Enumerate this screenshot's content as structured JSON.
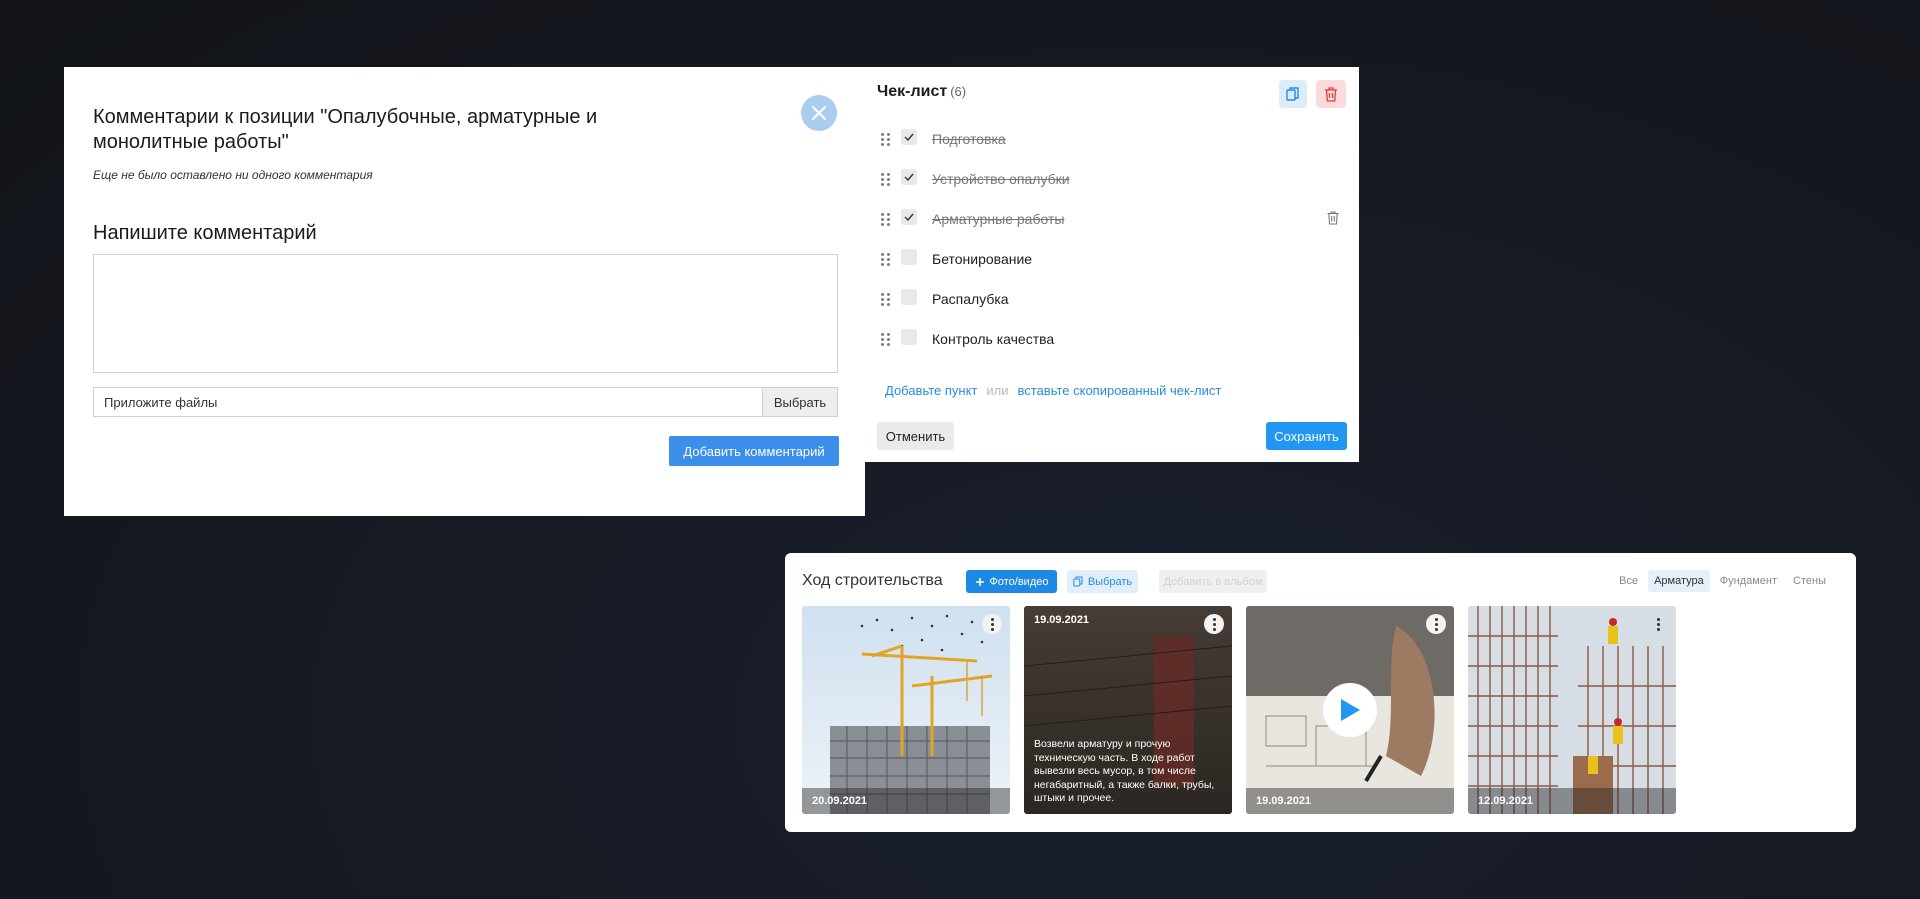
{
  "comments": {
    "title": "Комментарии к позиции \"Опалубочные, арматурные и монолитные работы\"",
    "empty_note": "Еще не было оставлено ни одного комментария",
    "write_heading": "Напишите комментарий",
    "textarea_value": "",
    "file_label": "Приложите файлы",
    "file_button": "Выбрать",
    "add_button": "Добавить комментарий"
  },
  "checklist": {
    "title": "Чек-лист",
    "count": "(6)",
    "items": [
      {
        "label": "Подготовка",
        "checked": true
      },
      {
        "label": "Устройство опалубки",
        "checked": true
      },
      {
        "label": "Арматурные работы",
        "checked": true
      },
      {
        "label": "Бетонирование",
        "checked": false
      },
      {
        "label": "Распалубка",
        "checked": false
      },
      {
        "label": "Контроль качества",
        "checked": false
      }
    ],
    "add_item_link": "Добавьте пункт",
    "or_text": "или",
    "paste_link": "вставьте скопированный чек-лист",
    "cancel_button": "Отменить",
    "save_button": "Сохранить"
  },
  "progress": {
    "title": "Ход строительства",
    "photo_button": "Фото/видео",
    "select_button": "Выбрать",
    "album_button": "Добавить в альбом",
    "filters": [
      "Все",
      "Арматура",
      "Фундамент",
      "Стены"
    ],
    "active_filter": "Арматура",
    "cards": [
      {
        "date": "20.09.2021"
      },
      {
        "date": "19.09.2021",
        "caption": "Возвели арматуру и прочую техническую часть. В ходе работ вывезли весь мусор, в том числе негабаритный, а также балки, трубы, штыки и прочее."
      },
      {
        "date": "19.09.2021"
      },
      {
        "date": "12.09.2021"
      }
    ]
  },
  "colors": {
    "primary": "#2196f3",
    "danger_bg": "#fbdcdc",
    "close_bg": "#a8cdef"
  }
}
